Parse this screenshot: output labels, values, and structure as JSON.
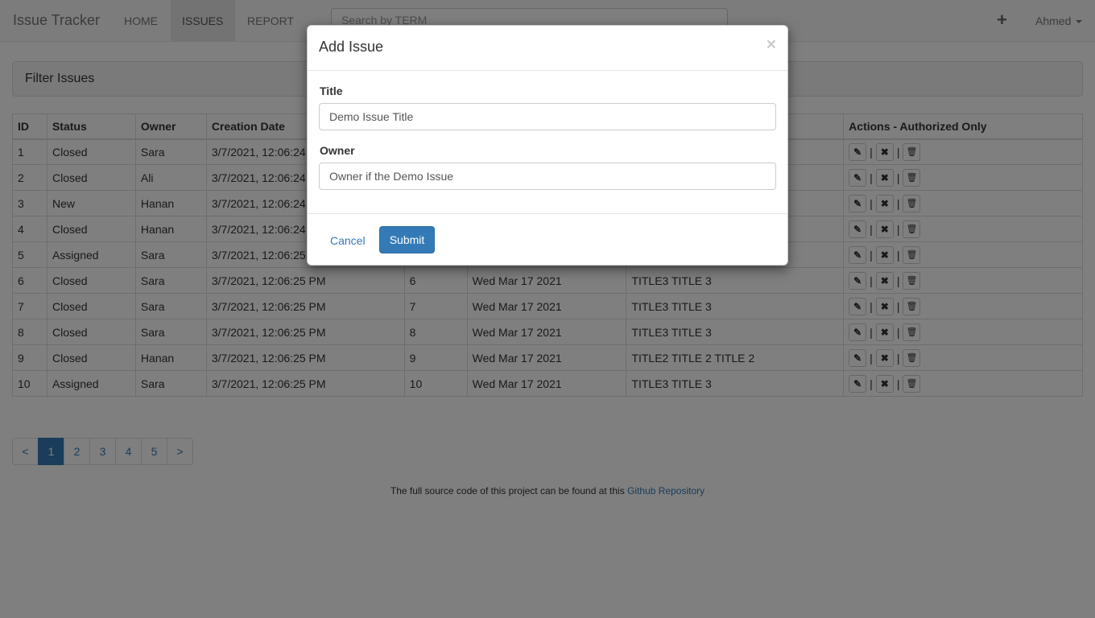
{
  "navbar": {
    "brand": "Issue Tracker",
    "items": [
      {
        "label": "HOME"
      },
      {
        "label": "ISSUES"
      },
      {
        "label": "REPORT"
      }
    ],
    "search_placeholder": "Search by TERM",
    "plus_icon": "plus-icon",
    "user": "Ahmed"
  },
  "filter": {
    "title": "Filter Issues"
  },
  "table": {
    "headers": [
      "ID",
      "Status",
      "Owner",
      "Creation Date",
      "",
      "",
      "",
      "Actions - Authorized Only"
    ],
    "rows": [
      [
        "1",
        "Closed",
        "Sara",
        "3/7/2021, 12:06:24",
        "",
        "",
        ""
      ],
      [
        "2",
        "Closed",
        "Ali",
        "3/7/2021, 12:06:24",
        "",
        "",
        ""
      ],
      [
        "3",
        "New",
        "Hanan",
        "3/7/2021, 12:06:24",
        "",
        "",
        ""
      ],
      [
        "4",
        "Closed",
        "Hanan",
        "3/7/2021, 12:06:24",
        "",
        "",
        ""
      ],
      [
        "5",
        "Assigned",
        "Sara",
        "3/7/2021, 12:06:25",
        "",
        "",
        ""
      ],
      [
        "6",
        "Closed",
        "Sara",
        "3/7/2021, 12:06:25 PM",
        "6",
        "Wed Mar 17 2021",
        "TITLE3 TITLE 3"
      ],
      [
        "7",
        "Closed",
        "Sara",
        "3/7/2021, 12:06:25 PM",
        "7",
        "Wed Mar 17 2021",
        "TITLE3 TITLE 3"
      ],
      [
        "8",
        "Closed",
        "Sara",
        "3/7/2021, 12:06:25 PM",
        "8",
        "Wed Mar 17 2021",
        "TITLE3 TITLE 3"
      ],
      [
        "9",
        "Closed",
        "Hanan",
        "3/7/2021, 12:06:25 PM",
        "9",
        "Wed Mar 17 2021",
        "TITLE2 TITLE 2 TITLE 2"
      ],
      [
        "10",
        "Assigned",
        "Sara",
        "3/7/2021, 12:06:25 PM",
        "10",
        "Wed Mar 17 2021",
        "TITLE3 TITLE 3"
      ]
    ],
    "action_icons": [
      "edit-icon",
      "close-icon",
      "trash-icon"
    ],
    "action_separator": "|"
  },
  "pagination": {
    "items": [
      "<",
      "1",
      "2",
      "3",
      "4",
      "5",
      ">"
    ],
    "active": "1"
  },
  "footer": {
    "text": "The full source code of this project can be found at this",
    "link": "Github Repository"
  },
  "modal": {
    "title": "Add Issue",
    "close": "×",
    "title_label": "Title",
    "title_value": "Demo Issue Title",
    "owner_label": "Owner",
    "owner_value": "Owner if the Demo Issue",
    "cancel": "Cancel",
    "submit": "Submit"
  },
  "colors": {
    "primary": "#337ab7",
    "navbar_bg": "#f8f8f8",
    "backdrop": "#000000"
  }
}
